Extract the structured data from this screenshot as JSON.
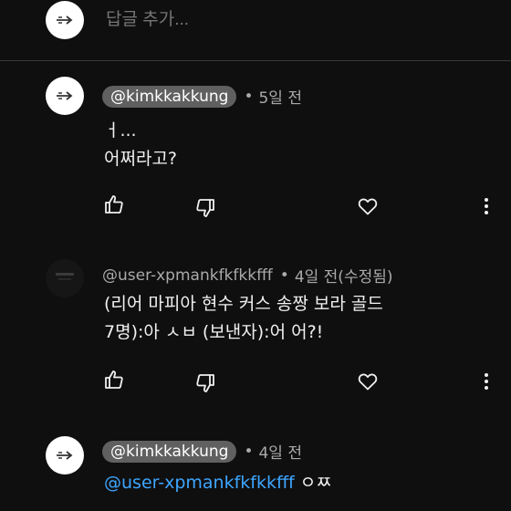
{
  "reply_bar": {
    "placeholder": "답글 추가..."
  },
  "comments": [
    {
      "handle": "@kimkkakkung",
      "handle_style": "owner",
      "time": "5일 전",
      "lines": [
        "ㅓ...",
        "어쩌라고?"
      ]
    },
    {
      "handle": "@user-xpmankfkfkkfff",
      "handle_style": "plain",
      "time": "4일 전(수정됨)",
      "lines": [
        "(리어 마피아 현수 커스 송짱 보라 골드",
        "7명):아 ㅅㅂ  (보낸자):어 어?!"
      ]
    },
    {
      "handle": "@kimkkakkung",
      "handle_style": "owner",
      "time": "4일 전",
      "mention": "@user-xpmankfkfkkfff",
      "text_after_mention": " ㅇㅉ"
    }
  ],
  "icons": {
    "like": "thumbs-up-icon",
    "dislike": "thumbs-down-icon",
    "heart": "heart-icon",
    "more": "more-vertical-icon"
  },
  "colors": {
    "background": "#0f0f0f",
    "mention": "#3ea6ff",
    "owner_pill": "#606060"
  }
}
